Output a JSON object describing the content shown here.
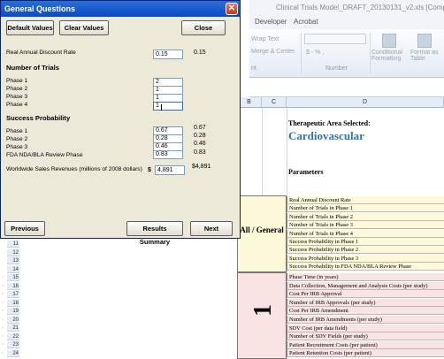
{
  "excel": {
    "title": "Clinical Trials Model_DRAFT_20130131_v2.xls [Comp",
    "tabs": [
      "Developer",
      "Acrobat"
    ],
    "ribbon": {
      "wrap_text": "Wrap Text",
      "merge_center": "Merge & Center",
      "number_format": "$ - % ,",
      "conditional_formatting": "Conditional Formatting",
      "format_as_table": "Format as Table",
      "group_alignment": "nt",
      "group_number": "Number"
    },
    "columns": [
      "B",
      "C",
      "D"
    ],
    "rows": [
      "11",
      "12",
      "13",
      "14",
      "15",
      "16",
      "17",
      "18",
      "19",
      "20",
      "21",
      "22",
      "23",
      "24"
    ],
    "therapeutic_label": "Therapeutic Area Selected:",
    "therapeutic_value": "Cardiovascular",
    "parameters_label": "Parameters",
    "all_general": "All / General",
    "section_number": "1",
    "general_params": [
      "Real Annual Discount Rate",
      "Number of Trials in Phase 1",
      "Number of Trials in Phase 2",
      "Number of Trials in Phase 3",
      "Number of Trials in Phase 4",
      "Success Probability in Phase 1",
      "Success Probability in Phase 2",
      "Success Probability in Phase 3",
      "Success Probability in FDA NDA/BLA Review Phase"
    ],
    "phase_params": [
      "Phase Time (in years)",
      "Data Collection, Management and Analysis Costs (per study)",
      "Cost Per IRB Approval",
      "Number of IRB Approvals (per study)",
      "Cost Per IRB Amendment",
      "Number of IRB Amendments (per study)",
      "SDV Cost (per data field)",
      "Number of SDV Fields (per study)",
      "Patient Recruitment Costs (per patient)",
      "Patient Retention Costs (per patient)"
    ]
  },
  "dialog": {
    "title": "General Questions",
    "default_values": "Default Values",
    "clear_values": "Clear Values",
    "close": "Close",
    "discount_label": "Real Annual Discount Rate",
    "discount_input": "0.15",
    "discount_current": "0.15",
    "trials_heading": "Number of Trials",
    "trials": [
      {
        "label": "Phase 1",
        "value": "2"
      },
      {
        "label": "Phase 2",
        "value": "1"
      },
      {
        "label": "Phase 3",
        "value": "1"
      },
      {
        "label": "Phase 4",
        "value": "1"
      }
    ],
    "success_heading": "Success Probability",
    "success": [
      {
        "label": "Phase 1",
        "value": "0.67",
        "current": "0.67"
      },
      {
        "label": "Phase 2",
        "value": "0.28",
        "current": "0.28"
      },
      {
        "label": "Phase 3",
        "value": "0.46",
        "current": "0.46"
      },
      {
        "label": "FDA NDA/BLA Review Phase",
        "value": "0.83",
        "current": "0.83"
      }
    ],
    "revenue_label": "Worldwide Sales Revenues (millions of 2008 dollars)",
    "currency_symbol": "$",
    "revenue_input": "4,891",
    "revenue_current": "$4,891",
    "previous": "Previous",
    "results_summary": "Results Summary",
    "next": "Next"
  }
}
